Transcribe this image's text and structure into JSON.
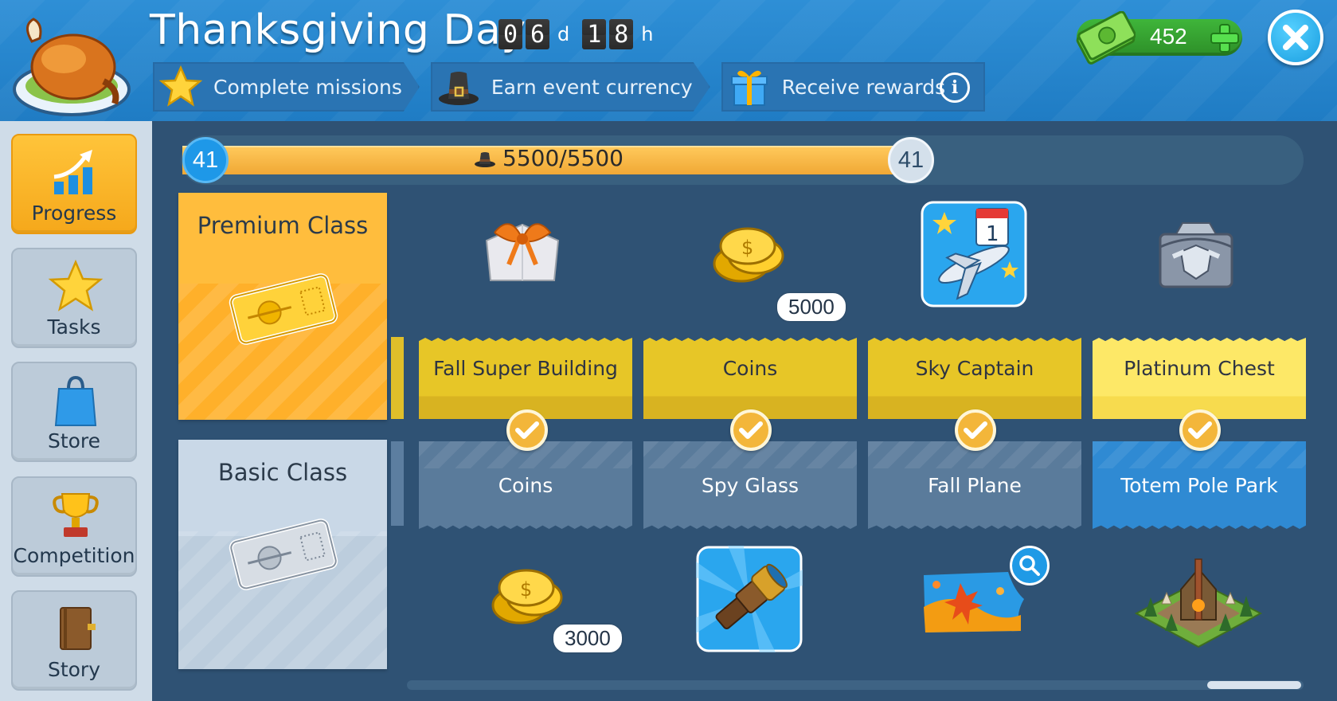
{
  "header": {
    "title": "Thanksgiving Day",
    "timer": {
      "days_digits": [
        "0",
        "6"
      ],
      "days_unit": "d",
      "hours_digits": [
        "1",
        "8"
      ],
      "hours_unit": "h"
    },
    "steps": [
      {
        "label": "Complete missions",
        "icon": "star-icon"
      },
      {
        "label": "Earn event currency",
        "icon": "pilgrim-hat-icon"
      },
      {
        "label": "Receive rewards",
        "icon": "gift-icon"
      }
    ],
    "info_label": "i",
    "currency": {
      "value": "452",
      "icon": "cash-icon"
    }
  },
  "sidebar": {
    "items": [
      {
        "label": "Progress",
        "icon": "progress-chart-icon",
        "active": true
      },
      {
        "label": "Tasks",
        "icon": "star-icon",
        "active": false
      },
      {
        "label": "Store",
        "icon": "shopping-bag-icon",
        "active": false
      },
      {
        "label": "Competition",
        "icon": "trophy-icon",
        "active": false
      },
      {
        "label": "Story",
        "icon": "book-icon",
        "active": false
      }
    ]
  },
  "progress": {
    "level_current": "41",
    "level_next": "41",
    "points_text": "5500/5500",
    "fill_fraction": 1.0
  },
  "classes": {
    "premium": {
      "title": "Premium Class"
    },
    "basic": {
      "title": "Basic Class"
    }
  },
  "rewards": [
    {
      "premium": {
        "label": "Fall Super Building",
        "icon": "fall-super-building-icon",
        "qty": ""
      },
      "basic": {
        "label": "Coins",
        "icon": "coins-icon",
        "qty": "3000"
      },
      "claimed": true
    },
    {
      "premium": {
        "label": "Coins",
        "icon": "coins-icon",
        "qty": "5000"
      },
      "basic": {
        "label": "Spy Glass",
        "icon": "spyglass-icon",
        "qty": ""
      },
      "claimed": true
    },
    {
      "premium": {
        "label": "Sky Captain",
        "icon": "sky-captain-plane-icon",
        "qty": ""
      },
      "basic": {
        "label": "Fall Plane",
        "icon": "fall-plane-skin-icon",
        "qty": ""
      },
      "claimed": true
    },
    {
      "premium": {
        "label": "Platinum Chest",
        "icon": "platinum-chest-icon",
        "qty": ""
      },
      "basic": {
        "label": "Totem Pole Park",
        "icon": "totem-pole-park-icon",
        "qty": ""
      },
      "claimed": true
    }
  ],
  "colors": {
    "header_blue": "#1f7cc4",
    "premium_gold": "#ffb02a",
    "currency_green": "#2d8f28",
    "close_blue": "#1a9ee0"
  }
}
